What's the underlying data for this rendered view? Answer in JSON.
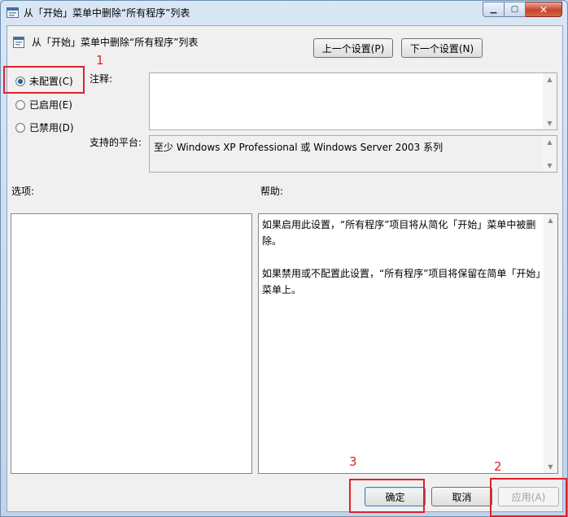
{
  "window": {
    "title": "从「开始」菜单中删除“所有程序”列表",
    "minimize_glyph": "▁",
    "maximize_glyph": "▢",
    "close_glyph": "✕"
  },
  "policy": {
    "name": "从「开始」菜单中删除“所有程序”列表"
  },
  "nav": {
    "prev_label": "上一个设置(P)",
    "next_label": "下一个设置(N)"
  },
  "state": {
    "options": [
      {
        "label": "未配置(C)",
        "checked": true
      },
      {
        "label": "已启用(E)",
        "checked": false
      },
      {
        "label": "已禁用(D)",
        "checked": false
      }
    ]
  },
  "comment": {
    "label": "注释:",
    "value": ""
  },
  "platform": {
    "label": "支持的平台:",
    "value": "至少 Windows XP Professional 或 Windows Server 2003 系列"
  },
  "sections": {
    "options_label": "选项:",
    "help_label": "帮助:"
  },
  "help": {
    "paragraphs": [
      "如果启用此设置，“所有程序”项目将从简化「开始」菜单中被删除。",
      "如果禁用或不配置此设置，“所有程序”项目将保留在简单「开始」菜单上。"
    ]
  },
  "footer": {
    "ok_label": "确定",
    "cancel_label": "取消",
    "apply_label": "应用(A)"
  },
  "annotations": {
    "n1": "1",
    "n2": "2",
    "n3": "3",
    "color": "#e0212a"
  }
}
